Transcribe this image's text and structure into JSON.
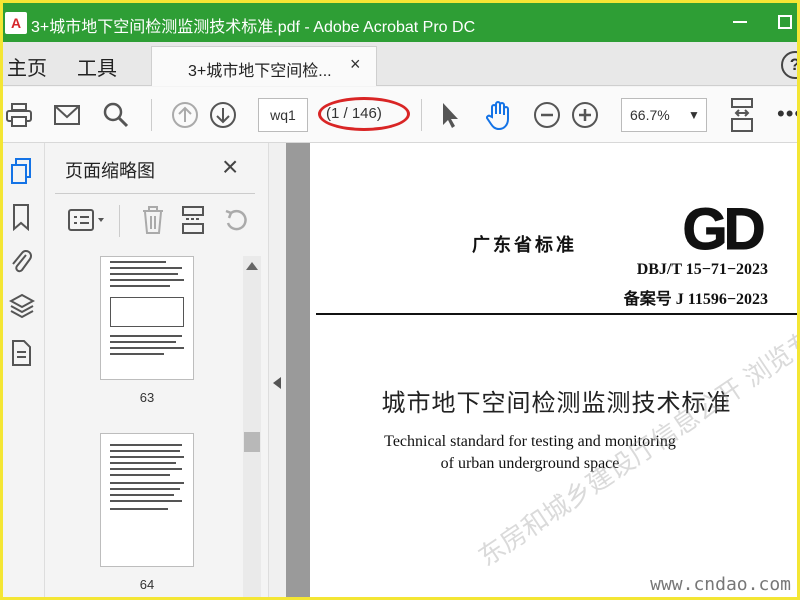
{
  "window": {
    "title": "3+城市地下空间检测监测技术标准.pdf - Adobe Acrobat Pro DC",
    "app_icon_letter": "A"
  },
  "menu": {
    "home": "主页",
    "tools": "工具"
  },
  "tab": {
    "label": "3+城市地下空间检...",
    "close": "×"
  },
  "toolbar": {
    "page_input": "wq1",
    "page_count": "(1 / 146)",
    "zoom": "66.7%",
    "zoom_arrow": "▼",
    "more": "•••"
  },
  "help": {
    "label": "?"
  },
  "panel": {
    "title": "页面缩略图",
    "close": "×",
    "thumbnails": [
      {
        "label": "63"
      },
      {
        "label": "64"
      }
    ]
  },
  "document": {
    "org": "广东省标准",
    "code": "DBJ/T 15−71−2023",
    "record": "备案号  J 11596−2023",
    "title_zh": "城市地下空间检测监测技术标准",
    "title_en_1": "Technical standard for testing and monitoring",
    "title_en_2": "of urban underground space",
    "watermark": "东房和城乡建设厅信息公开  浏览专用",
    "site_mark": "www.cndao.com"
  },
  "colors": {
    "titlebar": "#2e9e35",
    "frame": "#f4e634",
    "accent_blue": "#1473e6",
    "highlight_red": "#d92525"
  }
}
